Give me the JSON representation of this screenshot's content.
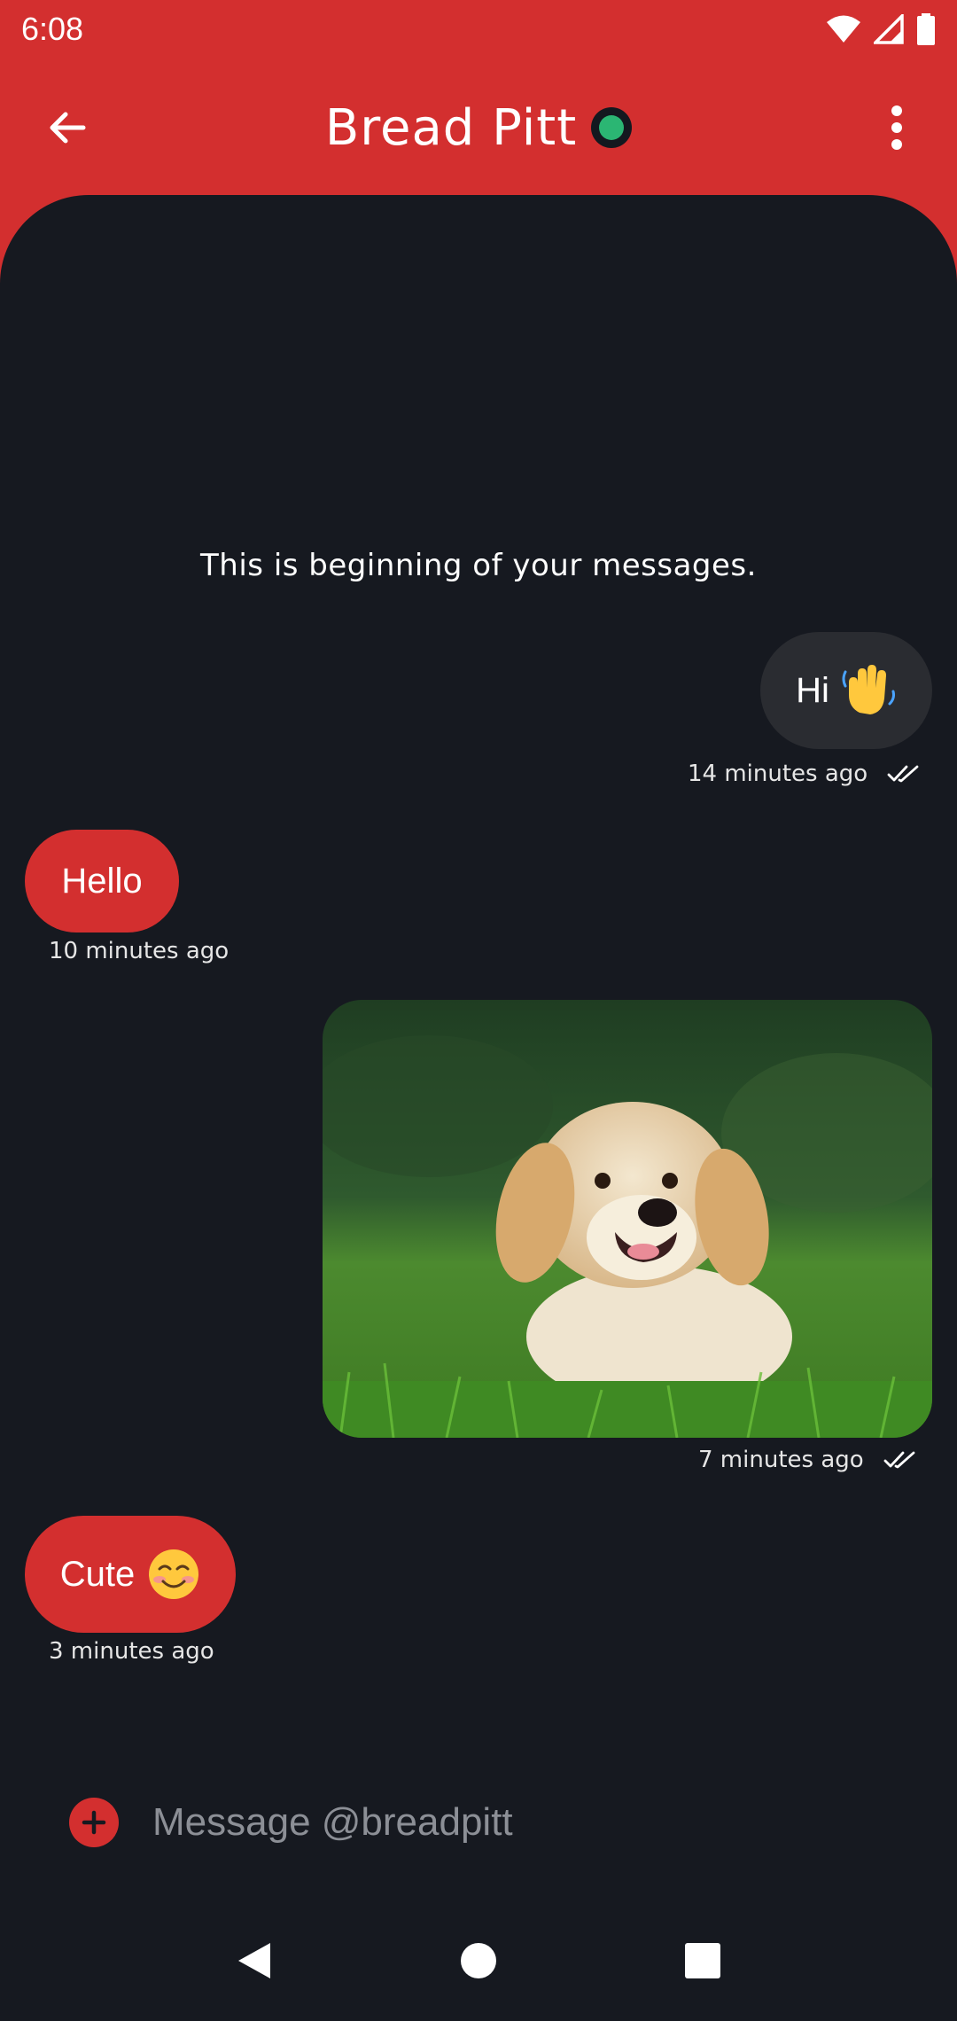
{
  "status_bar": {
    "time": "6:08",
    "icons": [
      "wifi-icon",
      "signal-icon",
      "battery-icon"
    ]
  },
  "header": {
    "back_icon": "arrow-back-icon",
    "title": "Bread Pitt",
    "presence": "online",
    "menu_icon": "more-vert-icon"
  },
  "chat": {
    "intro": "This is beginning of your messages.",
    "messages": [
      {
        "direction": "out",
        "text": "Hi",
        "emoji": "waving-hand-emoji",
        "time": "14 minutes ago",
        "status": "double-check-icon"
      },
      {
        "direction": "in",
        "text": "Hello",
        "time": "10 minutes ago"
      },
      {
        "direction": "out",
        "type": "image",
        "image": "golden-retriever-puppy-photo",
        "time": "7 minutes ago",
        "status": "double-check-icon"
      },
      {
        "direction": "in",
        "text": "Cute",
        "emoji": "smiling-face-emoji",
        "time": "3 minutes ago"
      }
    ]
  },
  "composer": {
    "add_icon": "plus-circle-icon",
    "placeholder": "Message @breadpitt",
    "value": ""
  },
  "nav": {
    "back": "nav-back-icon",
    "home": "nav-home-icon",
    "recents": "nav-recents-icon"
  },
  "colors": {
    "accent": "#d32f2f",
    "background": "#161920",
    "outgoing_bubble": "#2a2c31",
    "online": "#2bb673"
  }
}
